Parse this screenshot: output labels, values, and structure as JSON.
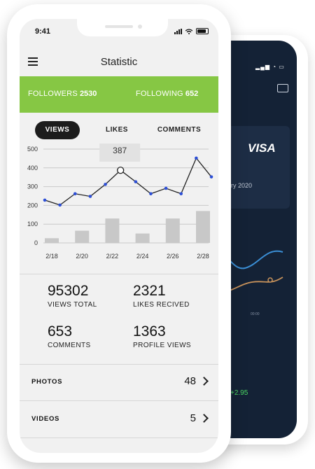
{
  "front": {
    "status_bar": {
      "time": "9:41"
    },
    "header": {
      "title": "Statistic"
    },
    "banner": {
      "followers_label": "FOLLOWERS",
      "followers_value": "2530",
      "following_label": "FOLLOWING",
      "following_value": "652",
      "color": "#86c744"
    },
    "tabs": [
      {
        "label": "VIEWS",
        "active": true
      },
      {
        "label": "LIKES",
        "active": false
      },
      {
        "label": "COMMENTS",
        "active": false
      }
    ],
    "tooltip": {
      "value": "387"
    },
    "stats": [
      {
        "value": "95302",
        "label": "VIEWS TOTAL"
      },
      {
        "value": "2321",
        "label": "LIKES RECIVED"
      },
      {
        "value": "653",
        "label": "COMMENTS"
      },
      {
        "value": "1363",
        "label": "PROFILE VIEWS"
      }
    ],
    "list": [
      {
        "label": "PHOTOS",
        "count": "48"
      },
      {
        "label": "VIDEOS",
        "count": "5"
      }
    ]
  },
  "back": {
    "card_brand": "VISA",
    "card_date_fragment": "ry 2020",
    "axis_fragment": "00:00",
    "value_fragment": "+2.95"
  },
  "chart_data": {
    "type": "line",
    "categories": [
      "2/18",
      "2/20",
      "2/22",
      "2/24",
      "2/26",
      "2/28"
    ],
    "x": [
      1,
      2,
      3,
      4,
      5,
      6,
      7,
      8,
      9,
      10,
      11,
      12,
      13,
      14
    ],
    "series": [
      {
        "values": [
          228,
          202,
          262,
          248,
          312,
          387,
          326,
          262,
          291,
          262,
          452,
          352
        ]
      }
    ],
    "bars": [
      25,
      65,
      130,
      50,
      130,
      170
    ],
    "yticks": [
      0,
      100,
      200,
      300,
      400,
      500
    ],
    "ylim": [
      0,
      500
    ],
    "highlight_index": 5,
    "line_color": "#222222",
    "point_color": "#2d4fd6"
  }
}
